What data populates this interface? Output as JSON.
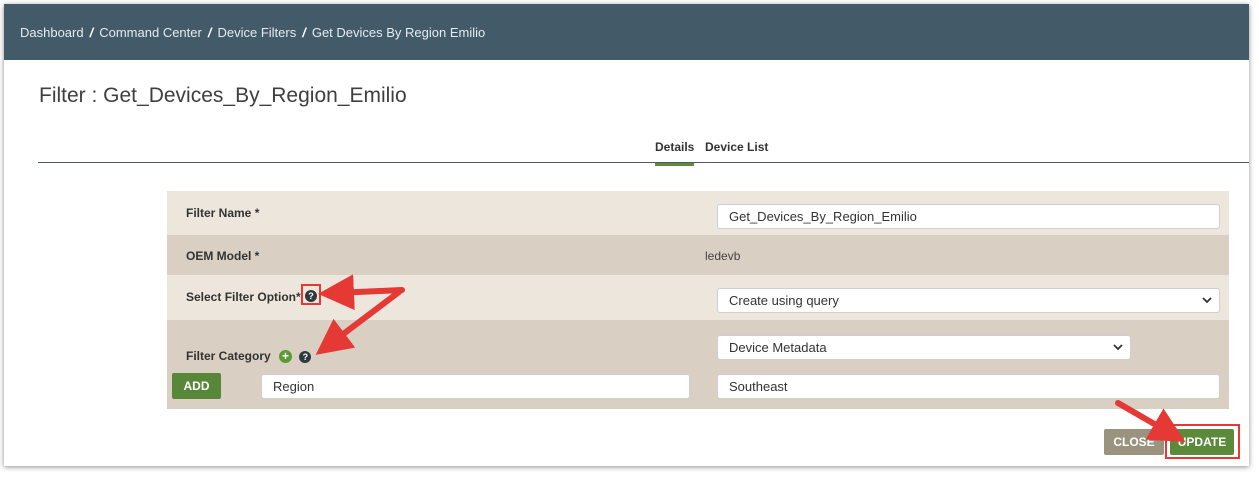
{
  "breadcrumb": {
    "items": [
      "Dashboard",
      "Command Center",
      "Device Filters"
    ],
    "current": "Get Devices By Region Emilio",
    "separator": "/"
  },
  "page": {
    "title": "Filter : Get_Devices_By_Region_Emilio"
  },
  "tabs": [
    {
      "label": "Details",
      "active": true
    },
    {
      "label": "Device List",
      "active": false
    }
  ],
  "form": {
    "filter_name": {
      "label": "Filter Name *",
      "value": "Get_Devices_By_Region_Emilio"
    },
    "oem_model": {
      "label": "OEM Model *",
      "value": "ledevb"
    },
    "filter_option": {
      "label": "Select Filter Option*",
      "selected": "Create using query"
    },
    "filter_category": {
      "label": "Filter Category",
      "selected": "Device Metadata",
      "add_label": "ADD",
      "key_value": "Region",
      "value_value": "Southeast"
    }
  },
  "actions": {
    "close_label": "CLOSE",
    "update_label": "UPDATE"
  },
  "icons": {
    "help": "question-circle-icon",
    "add": "plus-circle-icon",
    "dropdown": "chevron-down-icon",
    "annotation": "red-arrow-icon"
  },
  "colors": {
    "topbar": "#435a68",
    "accent_green": "#5a8a3a",
    "close_button": "#9a937f",
    "row_light": "#ede6dc",
    "row_dark": "#d9cfc2",
    "annotation_red": "#e53935"
  }
}
